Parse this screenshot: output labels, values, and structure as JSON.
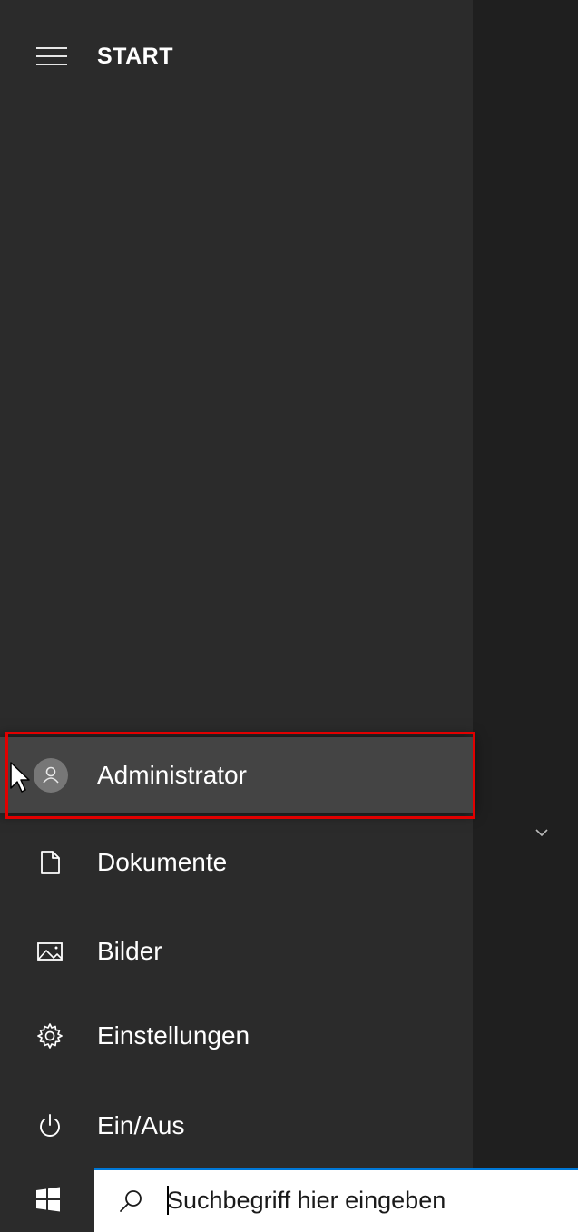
{
  "start_menu": {
    "title": "START",
    "user": {
      "label": "Administrator",
      "icon": "user-avatar-icon"
    },
    "items": [
      {
        "label": "Dokumente",
        "icon": "document-icon"
      },
      {
        "label": "Bilder",
        "icon": "picture-icon"
      },
      {
        "label": "Einstellungen",
        "icon": "gear-icon"
      },
      {
        "label": "Ein/Aus",
        "icon": "power-icon"
      }
    ]
  },
  "taskbar": {
    "start_icon": "windows-logo-icon",
    "search": {
      "placeholder": "Suchbegriff hier eingeben",
      "icon": "search-icon"
    }
  },
  "colors": {
    "nav_background": "#2b2b2b",
    "tile_background": "#1f1f1f",
    "selected_item": "#444444",
    "highlight_border": "#e10000",
    "search_accent": "#0078d7"
  }
}
